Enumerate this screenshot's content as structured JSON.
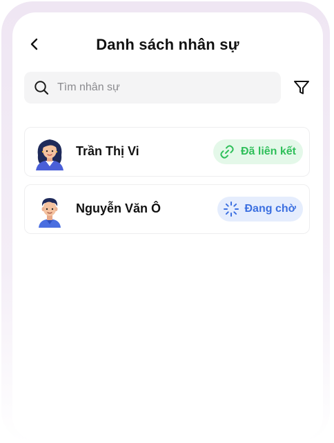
{
  "header": {
    "title": "Danh sách nhân sự"
  },
  "search": {
    "placeholder": "Tìm nhân sự"
  },
  "employees": [
    {
      "name": "Trần Thị Vi",
      "status": "Đã liên kết",
      "status_type": "linked",
      "avatar": "female-avatar"
    },
    {
      "name": "Nguyễn Văn Ô",
      "status": "Đang chờ",
      "status_type": "pending",
      "avatar": "male-avatar"
    }
  ],
  "colors": {
    "linked_text": "#2fbf5a",
    "linked_bg": "#e4f8e9",
    "pending_text": "#3b6fe0",
    "pending_bg": "#e5edfd"
  },
  "icons": {
    "back": "chevron-left-icon",
    "search": "search-icon",
    "filter": "filter-icon",
    "linked": "link-icon",
    "pending": "loader-icon"
  }
}
